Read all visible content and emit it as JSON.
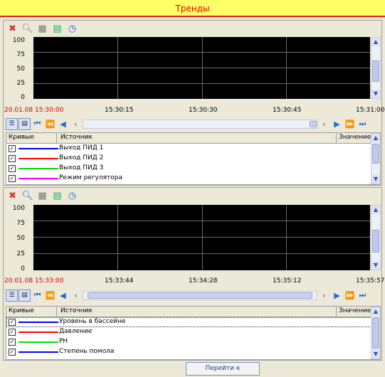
{
  "title": "Тренды",
  "colors": {
    "title_bg": "#ffff66",
    "title_text": "#e00000",
    "plot_bg": "#000000"
  },
  "toolbar_icons": [
    "clear-icon",
    "zoom-icon",
    "grid-icon",
    "export-icon",
    "timer-icon"
  ],
  "trend1": {
    "y_ticks": [
      "100",
      "75",
      "50",
      "25",
      "0"
    ],
    "x_ticks": [
      "20.01.08 15:30:00",
      "15:30:15",
      "15:30:30",
      "15:30:45",
      "15:31:00"
    ],
    "list_headers": {
      "curves": "Кривые",
      "source": "Источник",
      "value": "Значение"
    },
    "curves": [
      {
        "name": "Выход ПИД 1",
        "color": "#0000ff",
        "checked": true
      },
      {
        "name": "Выход ПИД 2",
        "color": "#ff0000",
        "checked": true
      },
      {
        "name": "Выход ПИД 3",
        "color": "#00e000",
        "checked": true
      },
      {
        "name": "Режим регулятора",
        "color": "#ff00ff",
        "checked": true
      }
    ]
  },
  "trend2": {
    "y_ticks": [
      "100",
      "75",
      "50",
      "25",
      "0"
    ],
    "x_ticks": [
      "20.01.08 15:33:00",
      "15:33:44",
      "15:34:28",
      "15:35:12",
      "15:35:57"
    ],
    "list_headers": {
      "curves": "Кривые",
      "source": "Источник",
      "value": "Значение"
    },
    "curves": [
      {
        "name": "Уровень в бассейне",
        "color": "#0000ff",
        "checked": true
      },
      {
        "name": "Давление",
        "color": "#ff0000",
        "checked": true
      },
      {
        "name": "PH",
        "color": "#00e000",
        "checked": true
      },
      {
        "name": "Степень помола",
        "color": "#0000ff",
        "checked": true
      }
    ]
  },
  "goto_button": "Перейти к мнемосхеме"
}
